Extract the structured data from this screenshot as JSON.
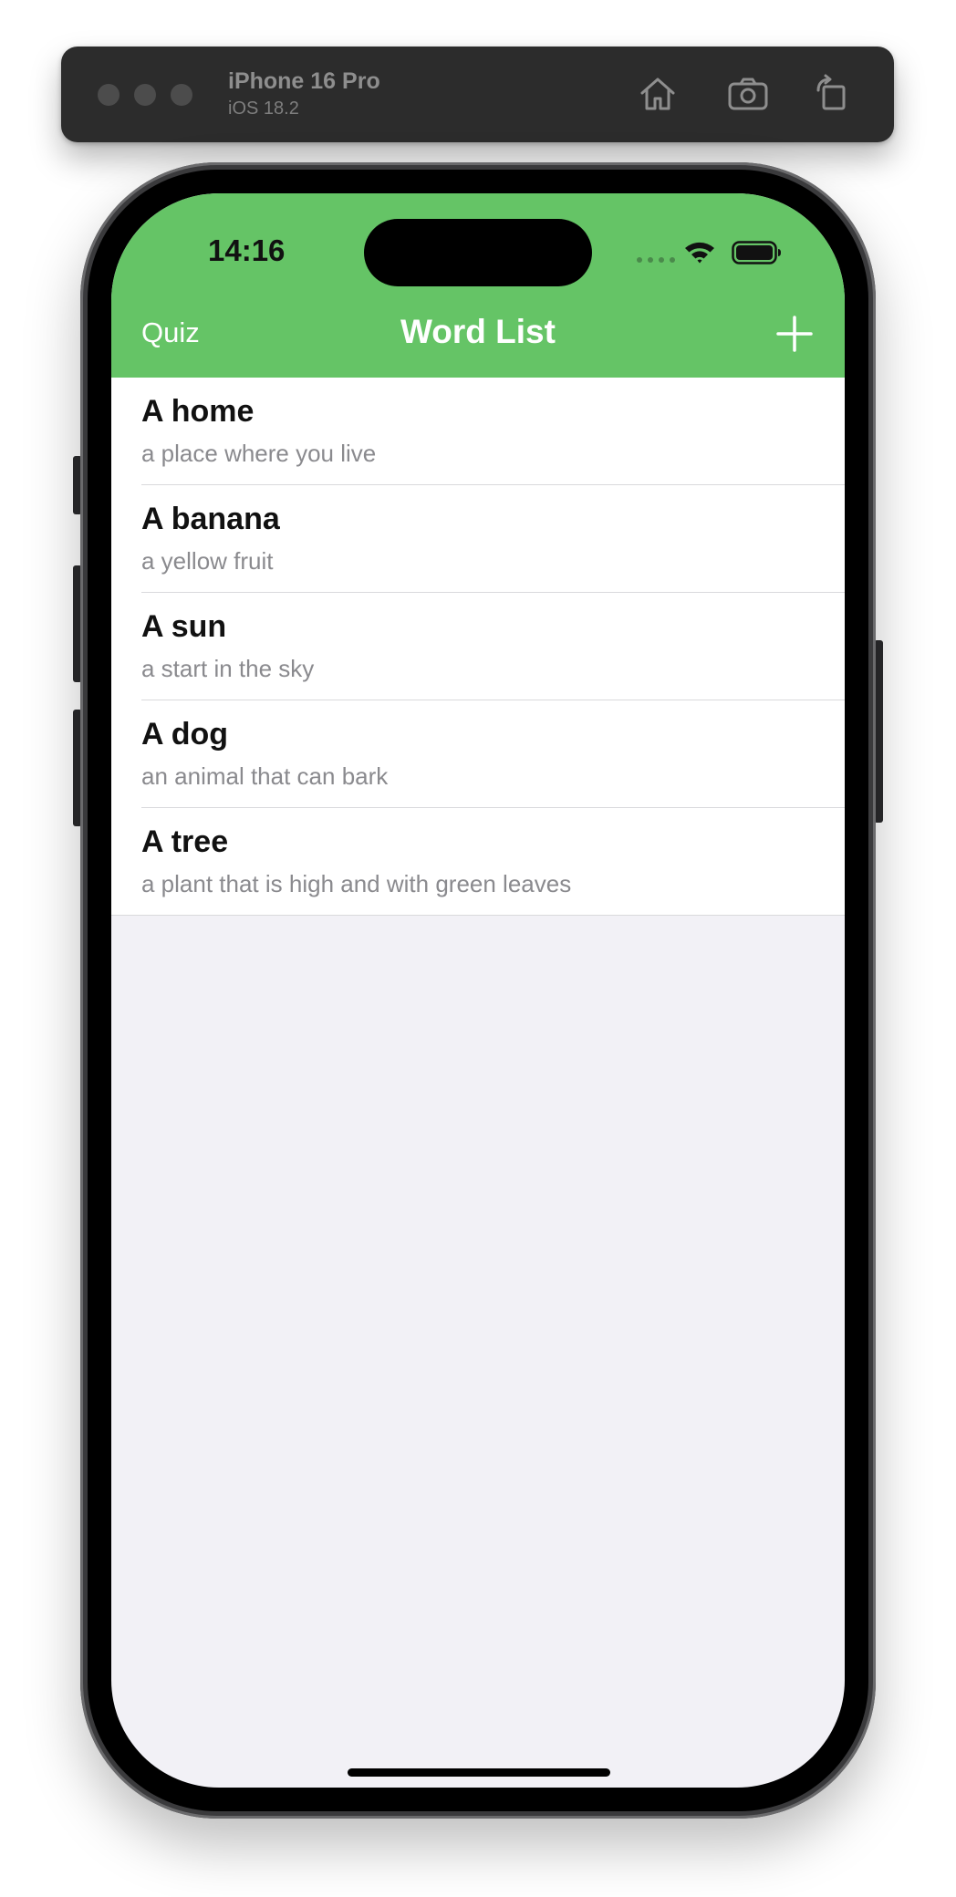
{
  "simulator": {
    "device_name": "iPhone 16 Pro",
    "os_version": "iOS 18.2",
    "icons": [
      "home-icon",
      "screenshot-icon",
      "rotate-icon"
    ]
  },
  "status_bar": {
    "time": "14:16"
  },
  "navigation": {
    "left_button": "Quiz",
    "title": "Word List",
    "right_icon": "plus-icon",
    "bar_color": "#65c466"
  },
  "words": [
    {
      "title": "A home",
      "subtitle": "a place where you live"
    },
    {
      "title": "A banana",
      "subtitle": "a yellow fruit"
    },
    {
      "title": "A sun",
      "subtitle": "a start in the sky"
    },
    {
      "title": "A dog",
      "subtitle": "an animal that can bark"
    },
    {
      "title": "A tree",
      "subtitle": "a plant that is high and with green leaves"
    }
  ]
}
